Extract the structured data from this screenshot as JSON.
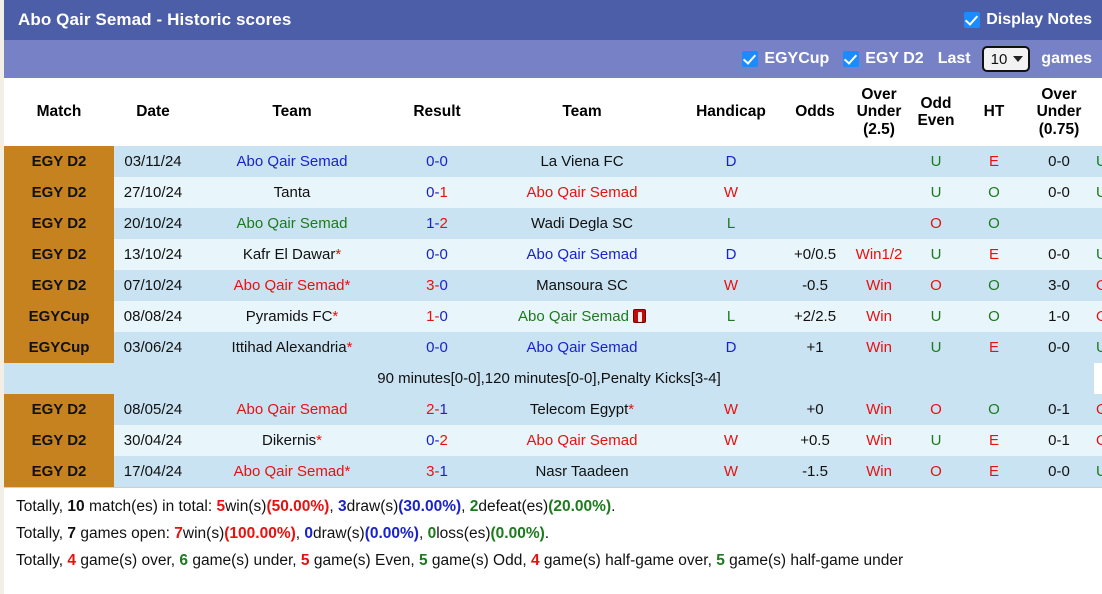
{
  "header": {
    "title": "Abo Qair Semad - Historic scores",
    "display_notes_label": "Display Notes",
    "display_notes_checked": true,
    "filters": [
      {
        "label": "EGYCup",
        "checked": true
      },
      {
        "label": "EGY D2",
        "checked": true
      }
    ],
    "last_label": "Last",
    "last_value": "10",
    "games_label": "games"
  },
  "colors": {
    "titlebar": "#4d5ea8",
    "filterbar": "#7681c6",
    "badge": "#c5821f",
    "row_odd": "#c9e3f2",
    "row_even": "#e8f5fb",
    "win_red": "#e8110f",
    "draw_blue": "#1a22cc",
    "loss_green": "#1d7a1d"
  },
  "table": {
    "columns": [
      "Match",
      "Date",
      "Team",
      "Result",
      "Team",
      "Handicap",
      "Odds",
      "Over\nUnder\n(2.5)",
      "Odd\nEven",
      "HT",
      "Over\nUnder\n(0.75)"
    ],
    "columns_parts": {
      "ou25": [
        "Over",
        "Under",
        "(2.5)"
      ],
      "oddeven": [
        "Odd",
        "Even"
      ],
      "ou075": [
        "Over",
        "Under",
        "(0.75)"
      ]
    },
    "rows": [
      {
        "badge": "EGY D2",
        "date": "03/11/24",
        "home": "Abo Qair Semad",
        "home_color": "blue",
        "home_star": false,
        "home_redcard": false,
        "score_home": "0",
        "score_home_color": "blue",
        "score_away": "0",
        "score_away_color": "blue",
        "away": "La Viena FC",
        "away_color": "black",
        "away_star": false,
        "away_redcard": false,
        "wdl": "D",
        "wdl_color": "blue",
        "handicap": "",
        "odds": "",
        "ou25": "U",
        "ou25_color": "green",
        "oddeven": "E",
        "oddeven_color": "red",
        "ht": "0-0",
        "ou075": "U",
        "ou075_color": "green"
      },
      {
        "badge": "EGY D2",
        "date": "27/10/24",
        "home": "Tanta",
        "home_color": "black",
        "home_star": false,
        "home_redcard": false,
        "score_home": "0",
        "score_home_color": "blue",
        "score_away": "1",
        "score_away_color": "red",
        "away": "Abo Qair Semad",
        "away_color": "red",
        "away_star": false,
        "away_redcard": false,
        "wdl": "W",
        "wdl_color": "red",
        "handicap": "",
        "odds": "",
        "ou25": "U",
        "ou25_color": "green",
        "oddeven": "O",
        "oddeven_color": "green",
        "ht": "0-0",
        "ou075": "U",
        "ou075_color": "green"
      },
      {
        "badge": "EGY D2",
        "date": "20/10/24",
        "home": "Abo Qair Semad",
        "home_color": "green",
        "home_star": false,
        "home_redcard": false,
        "score_home": "1",
        "score_home_color": "blue",
        "score_away": "2",
        "score_away_color": "red",
        "away": "Wadi Degla SC",
        "away_color": "black",
        "away_star": false,
        "away_redcard": false,
        "wdl": "L",
        "wdl_color": "green",
        "handicap": "",
        "odds": "",
        "ou25": "O",
        "ou25_color": "red",
        "oddeven": "O",
        "oddeven_color": "green",
        "ht": "",
        "ou075": "",
        "ou075_color": "green"
      },
      {
        "badge": "EGY D2",
        "date": "13/10/24",
        "home": "Kafr El Dawar",
        "home_color": "black",
        "home_star": true,
        "home_redcard": false,
        "score_home": "0",
        "score_home_color": "blue",
        "score_away": "0",
        "score_away_color": "blue",
        "away": "Abo Qair Semad",
        "away_color": "blue",
        "away_star": false,
        "away_redcard": false,
        "wdl": "D",
        "wdl_color": "blue",
        "handicap": "+0/0.5",
        "odds": "Win1/2",
        "ou25": "U",
        "ou25_color": "green",
        "oddeven": "E",
        "oddeven_color": "red",
        "ht": "0-0",
        "ou075": "U",
        "ou075_color": "green"
      },
      {
        "badge": "EGY D2",
        "date": "07/10/24",
        "home": "Abo Qair Semad",
        "home_color": "red",
        "home_star": true,
        "home_redcard": false,
        "score_home": "3",
        "score_home_color": "red",
        "score_away": "0",
        "score_away_color": "blue",
        "away": "Mansoura SC",
        "away_color": "black",
        "away_star": false,
        "away_redcard": false,
        "wdl": "W",
        "wdl_color": "red",
        "handicap": "-0.5",
        "odds": "Win",
        "ou25": "O",
        "ou25_color": "red",
        "oddeven": "O",
        "oddeven_color": "green",
        "ht": "3-0",
        "ou075": "O",
        "ou075_color": "red"
      },
      {
        "badge": "EGYCup",
        "date": "08/08/24",
        "home": "Pyramids FC",
        "home_color": "black",
        "home_star": true,
        "home_redcard": false,
        "score_home": "1",
        "score_home_color": "red",
        "score_away": "0",
        "score_away_color": "blue",
        "away": "Abo Qair Semad",
        "away_color": "green",
        "away_star": false,
        "away_redcard": true,
        "wdl": "L",
        "wdl_color": "green",
        "handicap": "+2/2.5",
        "odds": "Win",
        "ou25": "U",
        "ou25_color": "green",
        "oddeven": "O",
        "oddeven_color": "green",
        "ht": "1-0",
        "ou075": "O",
        "ou075_color": "red"
      },
      {
        "badge": "EGYCup",
        "date": "03/06/24",
        "home": "Ittihad Alexandria",
        "home_color": "black",
        "home_star": true,
        "home_redcard": false,
        "score_home": "0",
        "score_home_color": "blue",
        "score_away": "0",
        "score_away_color": "blue",
        "away": "Abo Qair Semad",
        "away_color": "blue",
        "away_star": false,
        "away_redcard": false,
        "wdl": "D",
        "wdl_color": "blue",
        "handicap": "+1",
        "odds": "Win",
        "ou25": "U",
        "ou25_color": "green",
        "oddeven": "E",
        "oddeven_color": "red",
        "ht": "0-0",
        "ou075": "U",
        "ou075_color": "green"
      }
    ],
    "note_row": {
      "after_row_index": 6,
      "text": "90 minutes[0-0],120 minutes[0-0],Penalty Kicks[3-4]"
    },
    "rows_after_note": [
      {
        "badge": "EGY D2",
        "date": "08/05/24",
        "home": "Abo Qair Semad",
        "home_color": "red",
        "home_star": false,
        "home_redcard": false,
        "score_home": "2",
        "score_home_color": "red",
        "score_away": "1",
        "score_away_color": "blue",
        "away": "Telecom Egypt",
        "away_color": "black",
        "away_star": true,
        "away_redcard": false,
        "wdl": "W",
        "wdl_color": "red",
        "handicap": "+0",
        "odds": "Win",
        "ou25": "O",
        "ou25_color": "red",
        "oddeven": "O",
        "oddeven_color": "green",
        "ht": "0-1",
        "ou075": "O",
        "ou075_color": "red"
      },
      {
        "badge": "EGY D2",
        "date": "30/04/24",
        "home": "Dikernis",
        "home_color": "black",
        "home_star": true,
        "home_redcard": false,
        "score_home": "0",
        "score_home_color": "blue",
        "score_away": "2",
        "score_away_color": "red",
        "away": "Abo Qair Semad",
        "away_color": "red",
        "away_star": false,
        "away_redcard": false,
        "wdl": "W",
        "wdl_color": "red",
        "handicap": "+0.5",
        "odds": "Win",
        "ou25": "U",
        "ou25_color": "green",
        "oddeven": "E",
        "oddeven_color": "red",
        "ht": "0-1",
        "ou075": "O",
        "ou075_color": "red"
      },
      {
        "badge": "EGY D2",
        "date": "17/04/24",
        "home": "Abo Qair Semad",
        "home_color": "red",
        "home_star": true,
        "home_redcard": false,
        "score_home": "3",
        "score_home_color": "red",
        "score_away": "1",
        "score_away_color": "blue",
        "away": "Nasr Taadeen",
        "away_color": "black",
        "away_star": false,
        "away_redcard": false,
        "wdl": "W",
        "wdl_color": "red",
        "handicap": "-1.5",
        "odds": "Win",
        "ou25": "O",
        "ou25_color": "red",
        "oddeven": "E",
        "oddeven_color": "red",
        "ht": "0-0",
        "ou075": "U",
        "ou075_color": "green"
      }
    ]
  },
  "summary": {
    "line1": {
      "prefix": "Totally,",
      "total": "10",
      "total_suffix": "match(es) in total:",
      "wins": "5",
      "wins_label": "win(s)",
      "wins_pct": "(50.00%)",
      "draws": "3",
      "draws_label": "draw(s)",
      "draws_pct": "(30.00%)",
      "defeats": "2",
      "defeats_label": "defeat(es)",
      "defeats_pct": "(20.00%)"
    },
    "line2": {
      "prefix": "Totally,",
      "total": "7",
      "total_suffix": "games open:",
      "wins": "7",
      "wins_label": "win(s)",
      "wins_pct": "(100.00%)",
      "draws": "0",
      "draws_label": "draw(s)",
      "draws_pct": "(0.00%)",
      "losses": "0",
      "losses_label": "loss(es)",
      "losses_pct": "(0.00%)"
    },
    "line3": {
      "prefix": "Totally,",
      "over": "4",
      "over_label": "game(s) over,",
      "under": "6",
      "under_label": "game(s) under,",
      "even": "5",
      "even_label": "game(s) Even,",
      "odd": "5",
      "odd_label": "game(s) Odd,",
      "half_over": "4",
      "half_over_label": "game(s) half-game over,",
      "half_under": "5",
      "half_under_label": "game(s) half-game under"
    }
  }
}
